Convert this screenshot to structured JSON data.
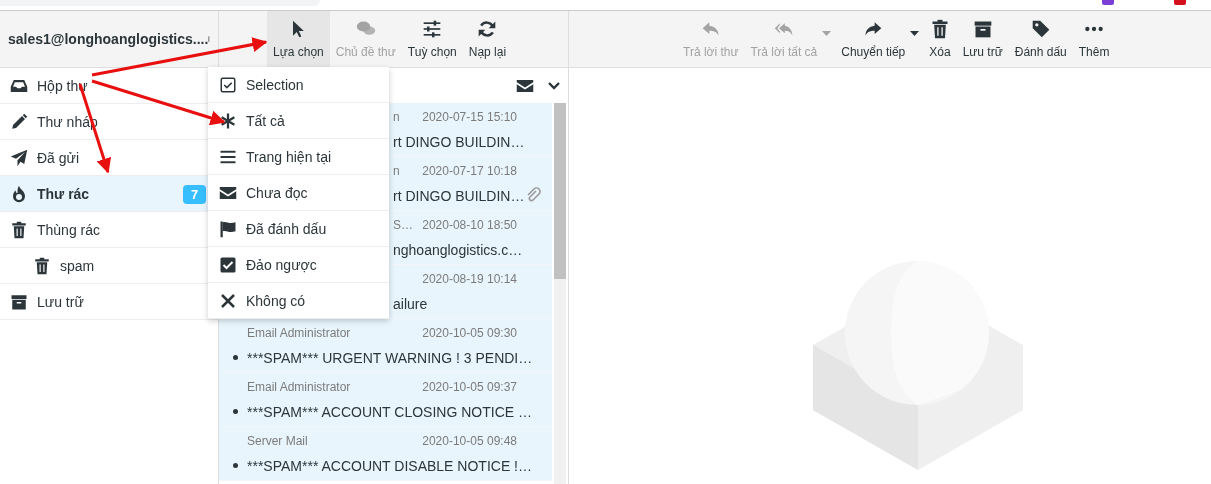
{
  "account": {
    "name": "sales1@longhoanglogistics...."
  },
  "list_toolbar": [
    {
      "kind": "select",
      "label": "Lựa chọn",
      "selected": true,
      "disabled": false
    },
    {
      "kind": "threads",
      "label": "Chủ đề thư",
      "selected": false,
      "disabled": true
    },
    {
      "kind": "options",
      "label": "Tuỳ chọn",
      "selected": false,
      "disabled": false
    },
    {
      "kind": "refresh",
      "label": "Nạp lại",
      "selected": false,
      "disabled": false
    }
  ],
  "message_toolbar": [
    {
      "kind": "reply",
      "label": "Trả lời thư",
      "disabled": true,
      "dropdown": false
    },
    {
      "kind": "reply-all",
      "label": "Trả lời tất cả",
      "disabled": true,
      "dropdown": true
    },
    {
      "kind": "forward",
      "label": "Chuyển tiếp",
      "disabled": false,
      "dropdown": true
    },
    {
      "kind": "delete",
      "label": "Xóa",
      "disabled": false,
      "dropdown": false
    },
    {
      "kind": "archive",
      "label": "Lưu trữ",
      "disabled": false,
      "dropdown": false
    },
    {
      "kind": "tag",
      "label": "Đánh dấu",
      "disabled": false,
      "dropdown": false
    },
    {
      "kind": "more",
      "label": "Thêm",
      "disabled": false,
      "dropdown": false
    }
  ],
  "folders": [
    {
      "kind": "inbox",
      "label": "Hộp thư",
      "selected": false
    },
    {
      "kind": "drafts",
      "label": "Thư nháp",
      "selected": false
    },
    {
      "kind": "sent",
      "label": "Đã gửi",
      "selected": false
    },
    {
      "kind": "junk",
      "label": "Thư rác",
      "selected": true,
      "count": "7"
    },
    {
      "kind": "trash",
      "label": "Thùng rác",
      "selected": false,
      "children": [
        {
          "kind": "trash",
          "label": "spam",
          "selected": false
        }
      ]
    },
    {
      "kind": "archive",
      "label": "Lưu trữ",
      "selected": false
    }
  ],
  "select_menu": [
    {
      "kind": "header",
      "label": "Selection"
    },
    {
      "kind": "all",
      "label": "Tất cả"
    },
    {
      "kind": "page",
      "label": "Trang hiện tại"
    },
    {
      "kind": "unread",
      "label": "Chưa đọc"
    },
    {
      "kind": "flagged",
      "label": "Đã đánh dấu"
    },
    {
      "kind": "invert",
      "label": "Đảo ngược"
    },
    {
      "kind": "none",
      "label": "Không có"
    }
  ],
  "message_list": {
    "covered_rows": [
      {
        "sender": "n",
        "date": "2020-07-15 15:10",
        "subject": "rt DINGO BUILDIN…",
        "attachment": false,
        "selected": true
      },
      {
        "sender": "n",
        "date": "2020-07-17 10:18",
        "subject": "rt DINGO BUILDIN…",
        "attachment": true,
        "selected": true
      },
      {
        "sender": "S…",
        "date": "2020-08-10 18:50",
        "subject": "nghoanglogistics.c…",
        "attachment": false,
        "selected": true
      },
      {
        "date": "2020-08-19 10:14",
        "subject": "ailure",
        "attachment": false,
        "selected": true
      }
    ],
    "rows": [
      {
        "sender": "Email Administrator",
        "date": "2020-10-05 09:30",
        "subject": "***SPAM*** URGENT WARNING ! 3 PENDI…",
        "unread": true,
        "selected": true
      },
      {
        "sender": "Email Administrator",
        "date": "2020-10-05 09:37",
        "subject": "***SPAM*** ACCOUNT CLOSING NOTICE …",
        "unread": true,
        "selected": true
      },
      {
        "sender": "Server Mail",
        "date": "2020-10-05 09:48",
        "subject": "***SPAM*** ACCOUNT DISABLE NOTICE !…",
        "unread": true,
        "selected": true
      }
    ]
  }
}
